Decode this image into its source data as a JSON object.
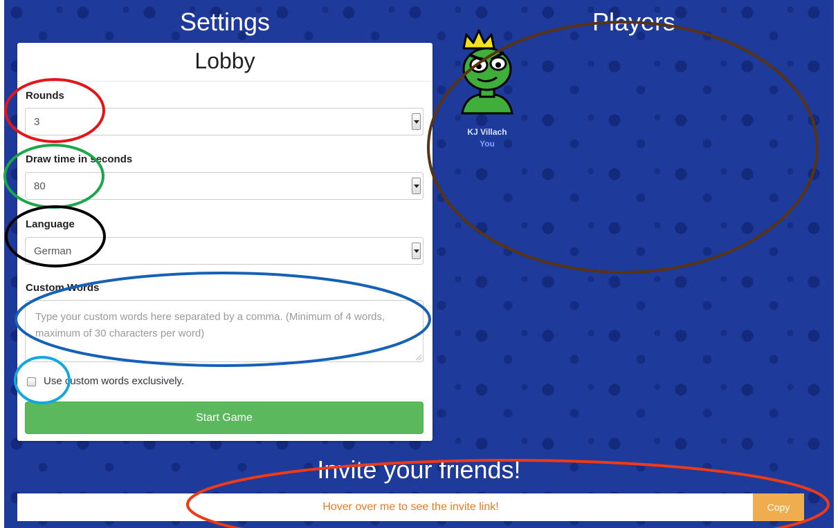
{
  "settings": {
    "title": "Settings",
    "lobby_title": "Lobby",
    "rounds": {
      "label": "Rounds",
      "value": "3"
    },
    "draw_time": {
      "label": "Draw time in seconds",
      "value": "80"
    },
    "language": {
      "label": "Language",
      "value": "German"
    },
    "custom_words": {
      "label": "Custom Words",
      "placeholder": "Type your custom words here separated by a comma. (Minimum of 4 words, maximum of 30 characters per word)"
    },
    "exclusive_checkbox": {
      "label": "Use custom words exclusively.",
      "checked": false
    },
    "start_button": "Start Game"
  },
  "players": {
    "title": "Players",
    "list": [
      {
        "name": "KJ Villach",
        "tag": "You",
        "owner_crown": true
      }
    ]
  },
  "invite": {
    "title": "Invite your friends!",
    "link_text": "Hover over me to see the invite link!",
    "copy_label": "Copy"
  },
  "icons": [
    "crown-icon",
    "avatar",
    "select-arrow-icon",
    "checkbox"
  ],
  "colors": {
    "background": "#1e3a9a",
    "start_button": "#5cb85c",
    "copy_button": "#f0ad4e",
    "invite_text": "#ea7a1f",
    "annotation_red": "#e3141a",
    "annotation_green": "#1aa74a",
    "annotation_black": "#000000",
    "annotation_blue": "#1560b8",
    "annotation_cyan": "#14a7e0",
    "annotation_brown": "#5a3410",
    "annotation_orange": "#ee3a16"
  }
}
